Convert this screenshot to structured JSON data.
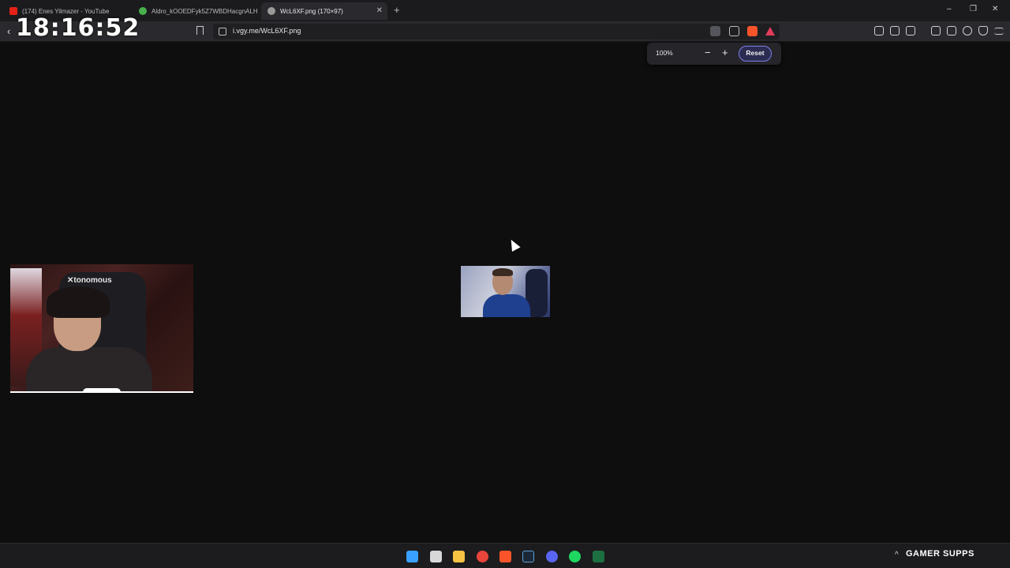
{
  "overlay": {
    "clock": "18:16:52"
  },
  "tabs": [
    {
      "title": "(174) Enes Yilmazer - YouTube",
      "favicon": "youtube-icon",
      "color": "#e62117"
    },
    {
      "title": "Aldro_kOOEDFyk5Z7WBDHacgnALH",
      "favicon": "pinwheel-icon",
      "color": "#48b04c"
    },
    {
      "title": "WcL6XF.png (170×97)",
      "favicon": "globe-icon",
      "color": "#9a9a9a"
    }
  ],
  "window_controls": {
    "minimize": "–",
    "restore": "❐",
    "close": "✕"
  },
  "newtab_label": "+",
  "address": {
    "url": "i.vgy.me/WcL6XF.png"
  },
  "zoom": {
    "level": "100%",
    "minus": "−",
    "plus": "+",
    "reset": "Reset"
  },
  "nav": {
    "back": "‹"
  },
  "taskbar": {
    "apps": [
      "windows-start-icon",
      "task-view-icon",
      "file-explorer-icon",
      "chrome-icon",
      "brave-icon",
      "steam-icon",
      "discord-icon",
      "spotify-icon",
      "excel-icon"
    ],
    "tray_chevron": "^",
    "brand": "GAMER SUPPS"
  },
  "colors": {
    "accent": "#7f7fe8",
    "background": "#0e0e0e",
    "brave": "#fb542b"
  }
}
